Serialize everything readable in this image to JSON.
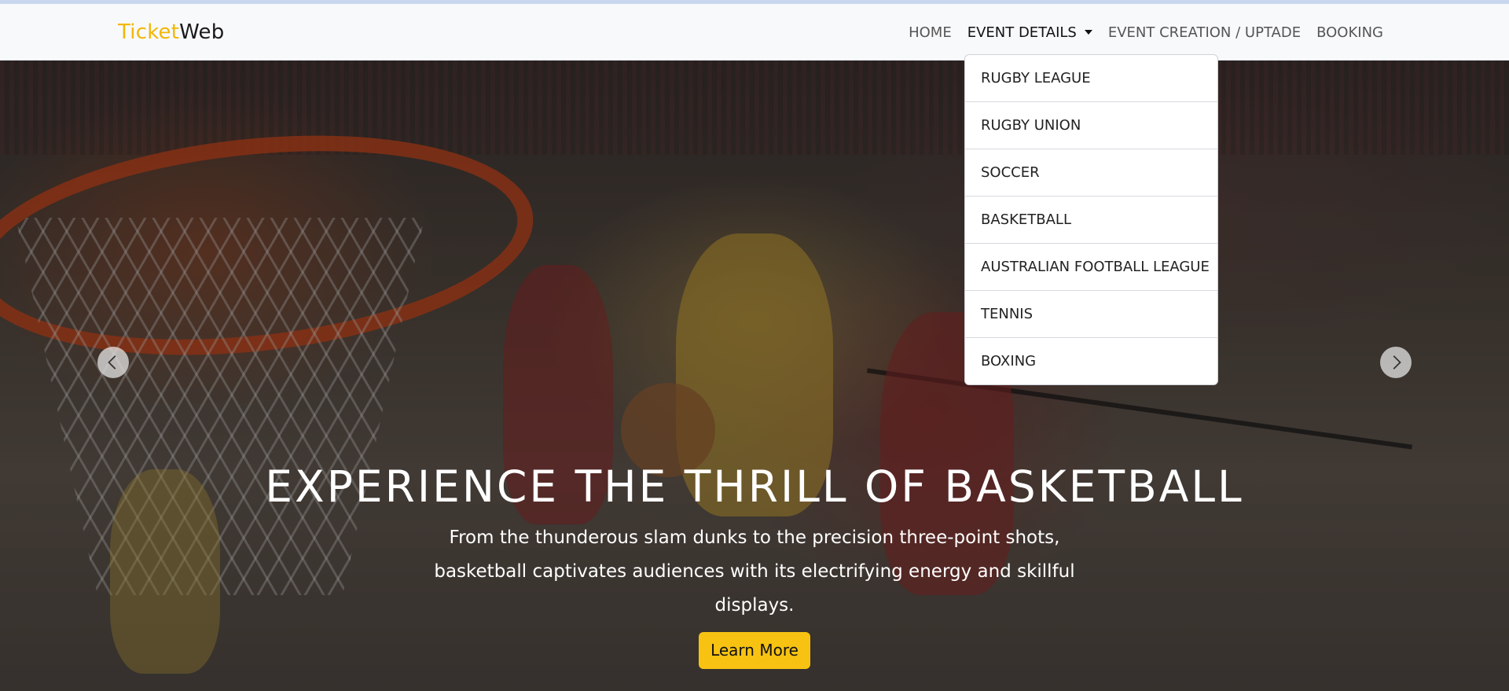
{
  "brand": {
    "part1": "Ticket",
    "part2": "Web"
  },
  "nav": {
    "home": "HOME",
    "event_details": "EVENT DETAILS",
    "event_creation": "EVENT CREATION / UPTADE",
    "booking": "BOOKING"
  },
  "dropdown": {
    "items": [
      {
        "label": "RUGBY LEAGUE"
      },
      {
        "label": "RUGBY UNION"
      },
      {
        "label": "SOCCER"
      },
      {
        "label": "BASKETBALL"
      },
      {
        "label": "AUSTRALIAN FOOTBALL LEAGUE"
      },
      {
        "label": "TENNIS"
      },
      {
        "label": "BOXING"
      }
    ]
  },
  "hero": {
    "title": "EXPERIENCE THE THRILL OF BASKETBALL",
    "description": "From the thunderous slam dunks to the precision three-point shots, basketball captivates audiences with its electrifying energy and skillful displays.",
    "button": "Learn More"
  },
  "colors": {
    "brand_accent": "#f2b705",
    "button": "#f7c212"
  },
  "icons": {
    "prev": "chevron-left-icon",
    "next": "chevron-right-icon",
    "caret": "caret-down-icon"
  }
}
